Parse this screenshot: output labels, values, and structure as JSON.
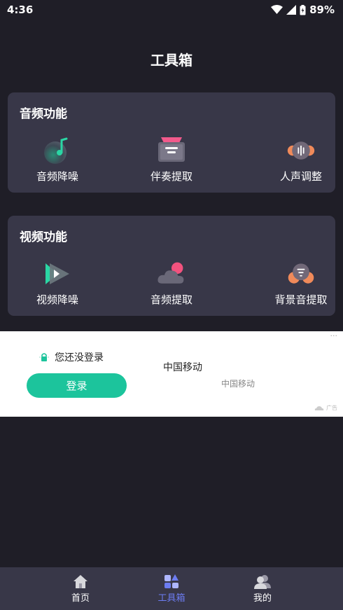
{
  "status_bar": {
    "time": "4:36",
    "battery": "89%"
  },
  "page": {
    "title": "工具箱"
  },
  "audio_section": {
    "title": "音频功能",
    "tools": [
      {
        "label": "音频降噪",
        "icon": "music-note-ball-icon"
      },
      {
        "label": "伴奏提取",
        "icon": "inbox-tray-icon"
      },
      {
        "label": "人声调整",
        "icon": "voice-wave-icon"
      }
    ]
  },
  "video_section": {
    "title": "视频功能",
    "tools": [
      {
        "label": "视频降噪",
        "icon": "play-icon"
      },
      {
        "label": "音频提取",
        "icon": "cloud-dot-icon"
      },
      {
        "label": "背景音提取",
        "icon": "equalizer-orb-icon"
      }
    ]
  },
  "ad": {
    "login_prompt": "您还没登录",
    "login_button": "登录",
    "carrier_main": "中国移动",
    "carrier_sub": "中国移动",
    "ad_tag": "广告",
    "more": "···"
  },
  "bottom_nav": {
    "items": [
      {
        "label": "首页",
        "icon": "home-icon",
        "active": false
      },
      {
        "label": "工具箱",
        "icon": "toolbox-icon",
        "active": true
      },
      {
        "label": "我的",
        "icon": "profile-icon",
        "active": false
      }
    ]
  },
  "colors": {
    "background": "#1f1e27",
    "card": "#383748",
    "accent": "#6c7cf2",
    "login_button": "#1cc49c"
  }
}
